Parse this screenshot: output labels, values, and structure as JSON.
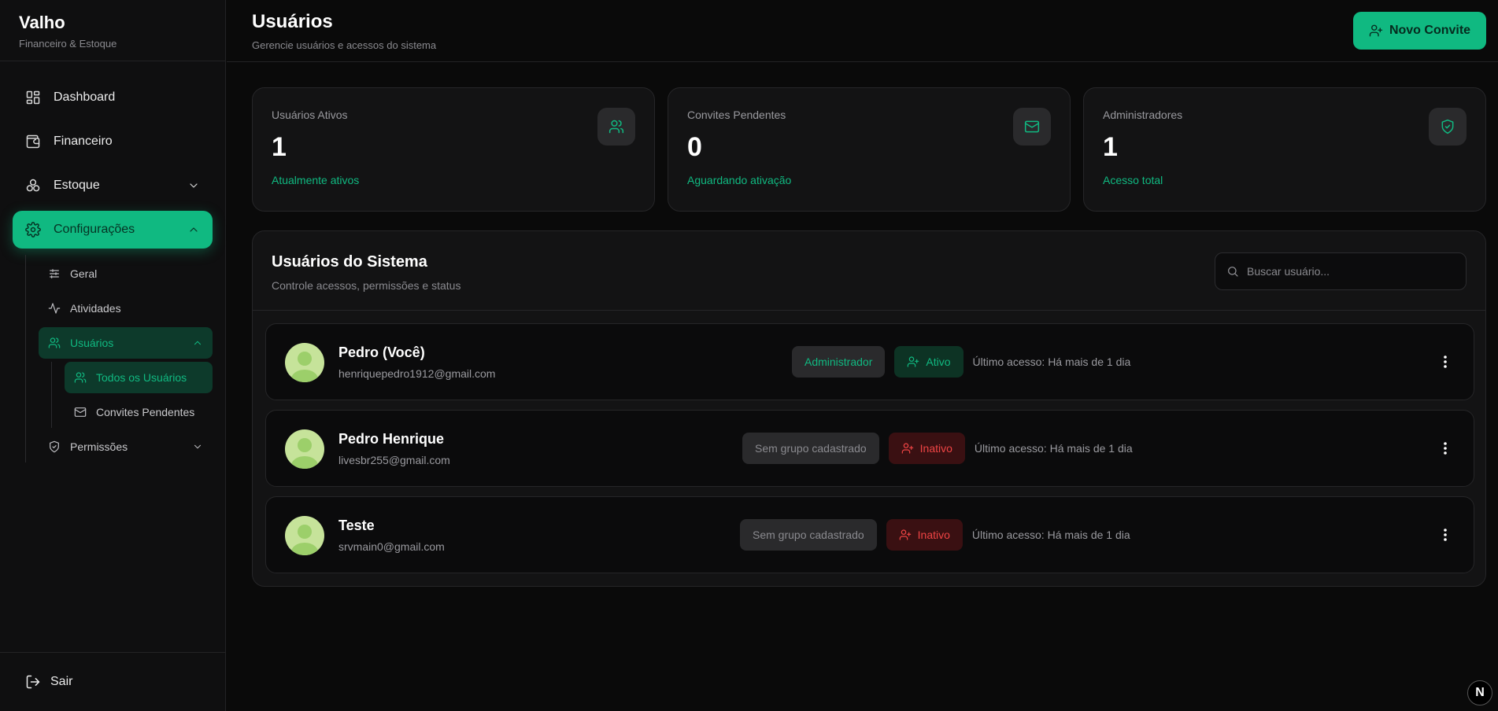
{
  "brand": {
    "name": "Valho",
    "subtitle": "Financeiro & Estoque"
  },
  "sidebar": {
    "items": [
      {
        "label": "Dashboard",
        "icon": "dashboard-icon"
      },
      {
        "label": "Financeiro",
        "icon": "wallet-icon"
      },
      {
        "label": "Estoque",
        "icon": "boxes-icon"
      },
      {
        "label": "Configurações",
        "icon": "gear-icon"
      }
    ],
    "sub_items": [
      {
        "label": "Geral",
        "icon": "sliders-icon"
      },
      {
        "label": "Atividades",
        "icon": "activity-icon"
      },
      {
        "label": "Usuários",
        "icon": "users-icon"
      },
      {
        "label": "Permissões",
        "icon": "shield-icon"
      }
    ],
    "user_sub_items": [
      {
        "label": "Todos os Usuários",
        "icon": "users-icon"
      },
      {
        "label": "Convites Pendentes",
        "icon": "mail-icon"
      }
    ],
    "logout_label": "Sair"
  },
  "header": {
    "title": "Usuários",
    "subtitle": "Gerencie usuários e acessos do sistema",
    "new_invite_label": "Novo Convite"
  },
  "stats": [
    {
      "label": "Usuários Ativos",
      "value": "1",
      "foot": "Atualmente ativos",
      "icon": "users-icon"
    },
    {
      "label": "Convites Pendentes",
      "value": "0",
      "foot": "Aguardando ativação",
      "icon": "mail-icon"
    },
    {
      "label": "Administradores",
      "value": "1",
      "foot": "Acesso total",
      "icon": "shield-check-icon"
    }
  ],
  "users_panel": {
    "title": "Usuários do Sistema",
    "subtitle": "Controle acessos, permissões e status",
    "search_placeholder": "Buscar usuário..."
  },
  "users": [
    {
      "name": "Pedro (Você)",
      "email": "henriquepedro1912@gmail.com",
      "group": "Administrador",
      "status": "Ativo",
      "last_access": "Último acesso: Há mais de 1 dia"
    },
    {
      "name": "Pedro Henrique",
      "email": "livesbr255@gmail.com",
      "group": "Sem grupo cadastrado",
      "status": "Inativo",
      "last_access": "Último acesso: Há mais de 1 dia"
    },
    {
      "name": "Teste",
      "email": "srvmain0@gmail.com",
      "group": "Sem grupo cadastrado",
      "status": "Inativo",
      "last_access": "Último acesso: Há mais de 1 dia"
    }
  ],
  "dev_badge": "N"
}
